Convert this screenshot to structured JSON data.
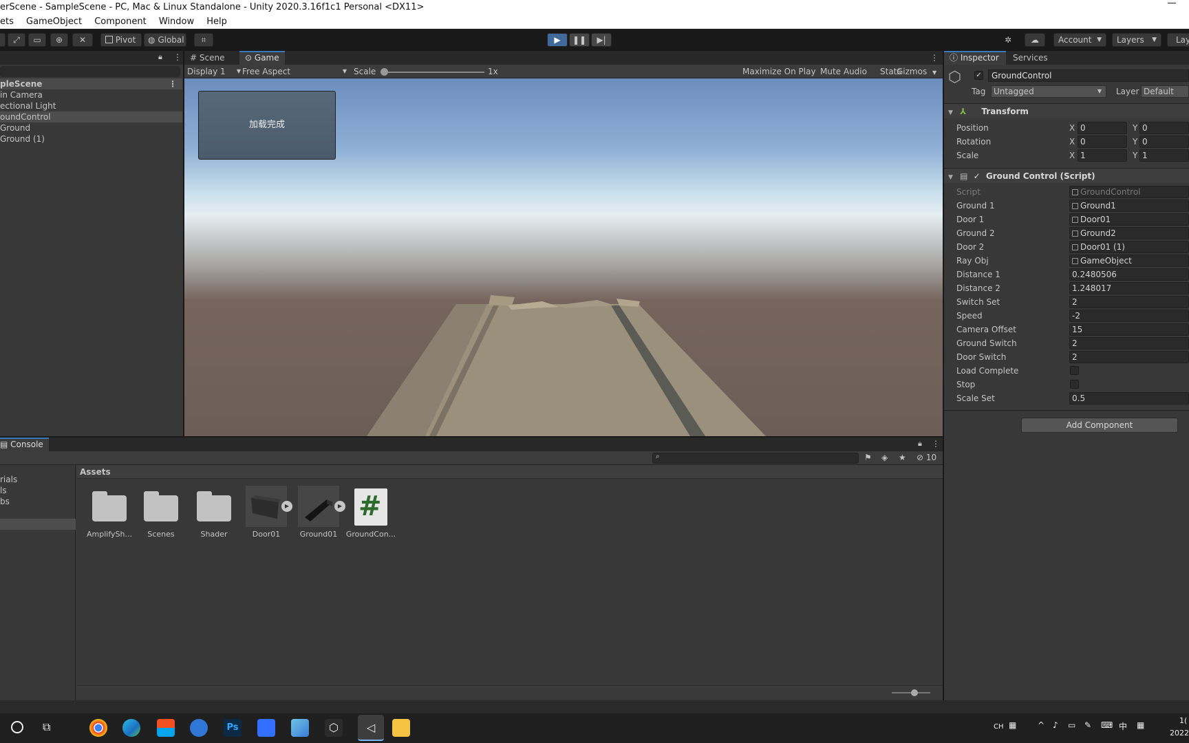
{
  "window": {
    "title": "erScene - SampleScene - PC, Mac & Linux Standalone - Unity 2020.3.16f1c1 Personal <DX11>"
  },
  "menu": [
    "ets",
    "GameObject",
    "Component",
    "Window",
    "Help"
  ],
  "toolbar": {
    "pivot": "Pivot",
    "global": "Global",
    "account": "Account",
    "layers": "Layers",
    "layout": "Lay"
  },
  "hierarchy": {
    "scene": "pleScene",
    "items": [
      "in Camera",
      "ectional Light",
      "oundControl",
      "Ground",
      "Ground (1)"
    ]
  },
  "game_view": {
    "tabs": [
      "Scene",
      "Game"
    ],
    "display": "Display 1",
    "aspect": "Free Aspect",
    "scale_label": "Scale",
    "scale_value": "1x",
    "maximize": "Maximize On Play",
    "mute": "Mute Audio",
    "stats": "Stats",
    "gizmos": "Gizmos",
    "ui_button_text": "加载完成"
  },
  "inspector": {
    "tabs": [
      "Inspector",
      "Services"
    ],
    "object_name": "GroundControl",
    "tag_label": "Tag",
    "tag_value": "Untagged",
    "layer_label": "Layer",
    "layer_value": "Default",
    "transform": {
      "title": "Transform",
      "rows": [
        {
          "label": "Position",
          "x": "0",
          "y": "0"
        },
        {
          "label": "Rotation",
          "x": "0",
          "y": "0"
        },
        {
          "label": "Scale",
          "x": "1",
          "y": "1"
        }
      ]
    },
    "script": {
      "title": "Ground Control (Script)",
      "fields": [
        {
          "label": "Script",
          "value": "GroundControl",
          "ref": true
        },
        {
          "label": "Ground 1",
          "value": "Ground1",
          "ref": true
        },
        {
          "label": "Door 1",
          "value": "Door01",
          "ref": true
        },
        {
          "label": "Ground 2",
          "value": "Ground2",
          "ref": true
        },
        {
          "label": "Door 2",
          "value": "Door01 (1)",
          "ref": true
        },
        {
          "label": "Ray Obj",
          "value": "GameObject",
          "ref": true
        },
        {
          "label": "Distance 1",
          "value": "0.2480506"
        },
        {
          "label": "Distance 2",
          "value": "1.248017"
        },
        {
          "label": "Switch Set",
          "value": "2"
        },
        {
          "label": "Speed",
          "value": "-2"
        },
        {
          "label": "Camera Offset",
          "value": "15"
        },
        {
          "label": "Ground Switch",
          "value": "2"
        },
        {
          "label": "Door Switch",
          "value": "2"
        }
      ],
      "checks": [
        "Load Complete",
        "Stop"
      ],
      "scale_set_label": "Scale Set",
      "scale_set_value": "0.5"
    },
    "add_component": "Add Component"
  },
  "console": {
    "tab": "Console",
    "hidden_count": "10",
    "sidebar_items": [
      "rials",
      "ls",
      "bs"
    ],
    "assets_header": "Assets",
    "assets": [
      "AmplifySh...",
      "Scenes",
      "Shader",
      "Door01",
      "Ground01",
      "GroundCon..."
    ]
  },
  "taskbar": {
    "ime": "CH",
    "lang": "中",
    "time": "1(",
    "date": "2022"
  },
  "colors": {
    "accent": "#3a79bb",
    "play_active": "#3f6a99"
  }
}
